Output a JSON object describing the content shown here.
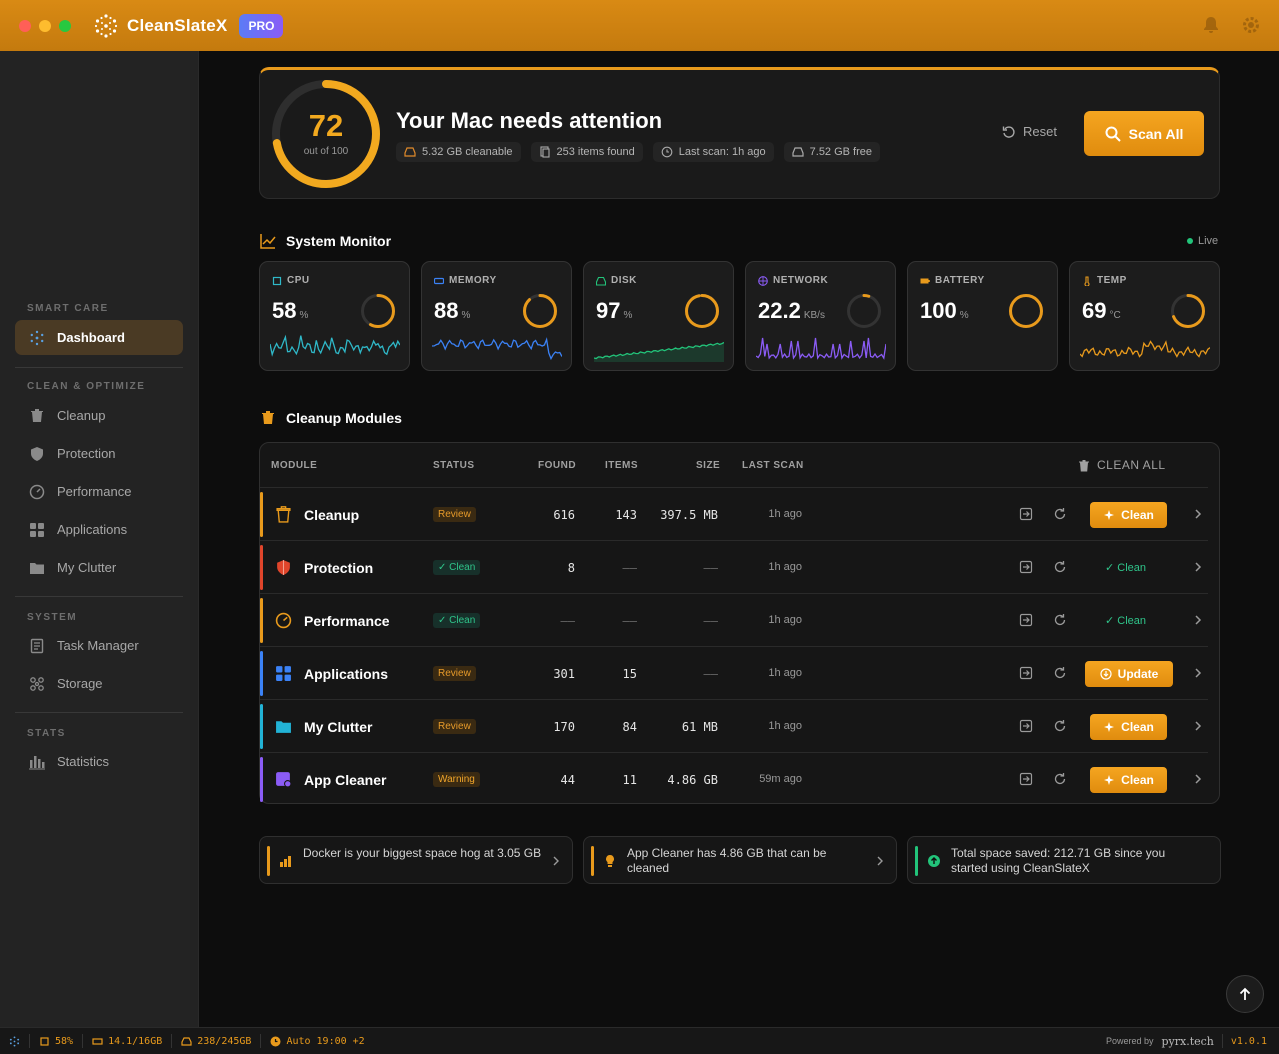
{
  "app": {
    "name": "CleanSlateX",
    "badge": "PRO"
  },
  "sidebar": {
    "sections": [
      {
        "label": "SMART CARE"
      },
      {
        "label": "CLEAN & OPTIMIZE"
      },
      {
        "label": "SYSTEM"
      },
      {
        "label": "STATS"
      }
    ],
    "items": [
      {
        "label": "Dashboard",
        "icon": "logo-icon"
      },
      {
        "label": "Cleanup",
        "icon": "trash-icon"
      },
      {
        "label": "Protection",
        "icon": "shield-icon"
      },
      {
        "label": "Performance",
        "icon": "gauge-icon"
      },
      {
        "label": "Applications",
        "icon": "grid-icon"
      },
      {
        "label": "My Clutter",
        "icon": "folder-icon"
      },
      {
        "label": "Task Manager",
        "icon": "document-icon"
      },
      {
        "label": "Storage",
        "icon": "storage-icon"
      },
      {
        "label": "Statistics",
        "icon": "bar-chart-icon"
      }
    ]
  },
  "hero": {
    "score": "72",
    "score_value": 0.72,
    "score_sub": "out of 100",
    "title": "Your Mac needs attention",
    "chips": [
      "5.32 GB cleanable",
      "253 items found",
      "Last scan: 1h ago",
      "7.52 GB free"
    ],
    "reset_label": "Reset",
    "scan_label": "Scan All"
  },
  "monitor": {
    "title": "System Monitor",
    "live_label": "Live",
    "metrics": [
      {
        "label": "CPU",
        "value": "58",
        "unit": "%",
        "fraction": 0.58,
        "color": "#2fb8c8"
      },
      {
        "label": "MEMORY",
        "value": "88",
        "unit": "%",
        "fraction": 0.88,
        "color": "#3b82f6"
      },
      {
        "label": "DISK",
        "value": "97",
        "unit": "%",
        "fraction": 0.97,
        "color": "#22c47a"
      },
      {
        "label": "NETWORK",
        "value": "22.2",
        "unit": "KB/s",
        "fraction": 0.05,
        "color": "#8b5cf6"
      },
      {
        "label": "BATTERY",
        "value": "100",
        "unit": "%",
        "fraction": 1.0,
        "color": "#e89a1c"
      },
      {
        "label": "TEMP",
        "value": "69",
        "unit": "°C",
        "fraction": 0.69,
        "color": "#e89a1c"
      }
    ]
  },
  "modules": {
    "title": "Cleanup Modules",
    "headers": {
      "module": "MODULE",
      "status": "STATUS",
      "found": "FOUND",
      "items": "ITEMS",
      "size": "SIZE",
      "last_scan": "LAST SCAN",
      "clean_all": "CLEAN ALL"
    },
    "rows": [
      {
        "name": "Cleanup",
        "status": "Review",
        "found": "616",
        "items": "143",
        "size": "397.5 MB",
        "last": "1h ago",
        "action": "Clean",
        "accent": "#e89a1c"
      },
      {
        "name": "Protection",
        "status": "✓ Clean",
        "found": "8",
        "items": "——",
        "size": "——",
        "last": "1h ago",
        "action": "✓ Clean",
        "accent": "#e0452b"
      },
      {
        "name": "Performance",
        "status": "✓ Clean",
        "found": "——",
        "items": "——",
        "size": "——",
        "last": "1h ago",
        "action": "✓ Clean",
        "accent": "#e89a1c"
      },
      {
        "name": "Applications",
        "status": "Review",
        "found": "301",
        "items": "15",
        "size": "——",
        "last": "1h ago",
        "action": "Update",
        "accent": "#3b82f6"
      },
      {
        "name": "My Clutter",
        "status": "Review",
        "found": "170",
        "items": "84",
        "size": "61 MB",
        "last": "1h ago",
        "action": "Clean",
        "accent": "#22b3d6"
      },
      {
        "name": "App Cleaner",
        "status": "Warning",
        "found": "44",
        "items": "11",
        "size": "4.86 GB",
        "last": "59m ago",
        "action": "Clean",
        "accent": "#8b5cf6"
      }
    ]
  },
  "tips": [
    {
      "text": "Docker is your biggest space hog at 3.05 GB",
      "color": "#e89a1c"
    },
    {
      "text": "App Cleaner has 4.86 GB that can be cleaned",
      "color": "#e89a1c"
    },
    {
      "text": "Total space saved: 212.71 GB since you started using CleanSlateX",
      "color": "#22c47a"
    }
  ],
  "statusbar": {
    "cpu": "58%",
    "memory": "14.1/16GB",
    "disk": "238/245GB",
    "auto": "Auto 19:00 +2",
    "powered": "Powered by",
    "brand": "pyrx.tech",
    "version": "v1.0.1"
  }
}
